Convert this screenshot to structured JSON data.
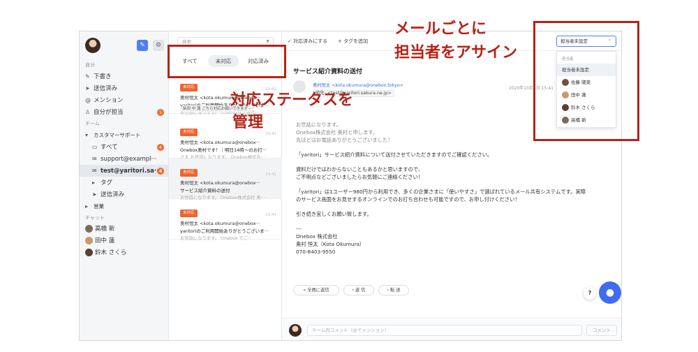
{
  "sidebar": {
    "sections": {
      "personal": "自分",
      "team": "チーム",
      "chat": "チャット"
    },
    "personal_items": [
      {
        "label": "下書き",
        "icon": "pencil-icon"
      },
      {
        "label": "送信済み",
        "icon": "send-icon"
      },
      {
        "label": "メンション",
        "icon": "at-icon"
      },
      {
        "label": "自分が担当",
        "icon": "person-icon",
        "badge": "1"
      }
    ],
    "team_groups": [
      {
        "label": "カスタマーサポート",
        "expanded": true
      },
      {
        "label": "営業",
        "expanded": false
      }
    ],
    "team_items": [
      {
        "label": "すべて",
        "icon": "inbox-icon",
        "badge": "4"
      },
      {
        "label": "support@exampl···",
        "icon": "mail-icon"
      },
      {
        "label": "test@yaritori.sa···",
        "icon": "mail-icon",
        "badge": "4"
      },
      {
        "label": "タグ",
        "icon": "tag-icon"
      },
      {
        "label": "送信済み",
        "icon": "send-icon"
      }
    ],
    "chat_members": [
      "高橋 新",
      "田中 蓮",
      "鈴木 さくら"
    ]
  },
  "list": {
    "search_placeholder": "検索",
    "tabs": [
      "すべて",
      "未対応",
      "対応済み"
    ],
    "mails": [
      {
        "tag": "未対応",
        "from": "奥村恒太 <kota.okumura@onebox···",
        "time": "15:43",
        "subject": "yaritoriのご利用開始ありがとうございま···",
        "preview": "お世話になります。 Onebox株式会社···",
        "assignee": "柴田 中 蓮  ごちら対応お願いできます···"
      },
      {
        "tag": "未対応",
        "from": "奥村恒太 <kota.okumura@onebox···",
        "time": "15:41",
        "subject": "Onebox奥村です！｜明日14時〜のお打···",
        "preview": "さま お世話になります。 Onebox株式会···"
      },
      {
        "tag": "未対応",
        "from": "奥村恒太 <kota.okumura@onebox···",
        "time": "15:41",
        "subject": "サービス紹介資料の送付",
        "preview": "お世話になります。 Onebox株式会社 奥···"
      },
      {
        "tag": "未対応",
        "from": "奥村恒太 <kota.okumura@onebox···",
        "time": "15:41",
        "subject": "yaritoriのご利用開始ありがとうございま···",
        "preview": "お世話になります。 Onebox でご··· "
      }
    ]
  },
  "toolbar": {
    "done_label": "対応済みにする",
    "tag_label": "タグを追加"
  },
  "assign": {
    "current": "担当者未設定",
    "header": "担当者",
    "options": [
      "担当者未設定",
      "佐藤 陽菜",
      "田中 蓮",
      "鈴木 さくら",
      "高橋 新"
    ]
  },
  "message": {
    "subject": "サービス紹介資料の送付",
    "sender": "奥村恒太 <kota.okumura@onebox.tokyo>",
    "to": "宛先: <test@yaritori.sakura.ne.jp>",
    "date": "2020年10月4日 15:41",
    "body": [
      "お世話になります。",
      "Onebox株式会社 奥村と申します。",
      "先ほどはお電話ありがとうございました！",
      "「yaritori」サービス紹介資料について送付させていただきますのでご確認ください。",
      "資料だけではわからないこともあるかと思いますので、",
      "ご不明点などございましたらお気軽にご連絡ください！",
      "「yaritori」は1ユーザー980円から利用でき、多くの企業さまに「使いやすさ」で選ばれているメール共有システムです。実際",
      "のサービス画面をお見せするオンラインでのお打ち合わせも可能ですので、お申し付けください！",
      "引き続き宜しくお願い致します。",
      "---",
      "Onebox 株式会社",
      "奥村 恒太（Kota Okumura）",
      "070-8403-9550"
    ],
    "actions": [
      "全員に返信",
      "返 信",
      "転 送"
    ]
  },
  "comment": {
    "placeholder": "チーム内コメント（@でメンション）",
    "button": "コメント"
  },
  "help_label": "?",
  "annotations": {
    "status_caption_1": "対応ステータスを",
    "status_caption_2": "管理",
    "assign_caption_1": "メールごとに",
    "assign_caption_2": "担当者をアサイン"
  },
  "colors": {
    "accent": "#4f7ef7",
    "tag": "#f2622e",
    "badge": "#f26b2b",
    "annotation": "#b42316"
  }
}
